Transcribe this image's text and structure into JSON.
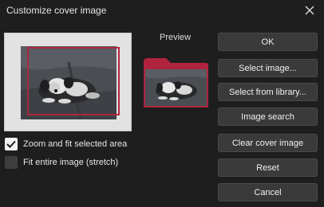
{
  "window": {
    "title": "Customize cover image",
    "close_icon": "close-icon"
  },
  "preview": {
    "label": "Preview"
  },
  "buttons": {
    "ok": "OK",
    "select_image": "Select image...",
    "select_from_library": "Select from library...",
    "image_search": "Image search",
    "clear_cover_image": "Clear cover image",
    "reset": "Reset",
    "cancel": "Cancel"
  },
  "options": {
    "zoom_fit": {
      "label": "Zoom and fit selected area",
      "checked": true
    },
    "fit_entire": {
      "label": "Fit entire image (stretch)",
      "checked": false
    }
  },
  "colors": {
    "accent": "#b0243f",
    "background": "#1e1e1e",
    "button": "#3a3a3a"
  }
}
